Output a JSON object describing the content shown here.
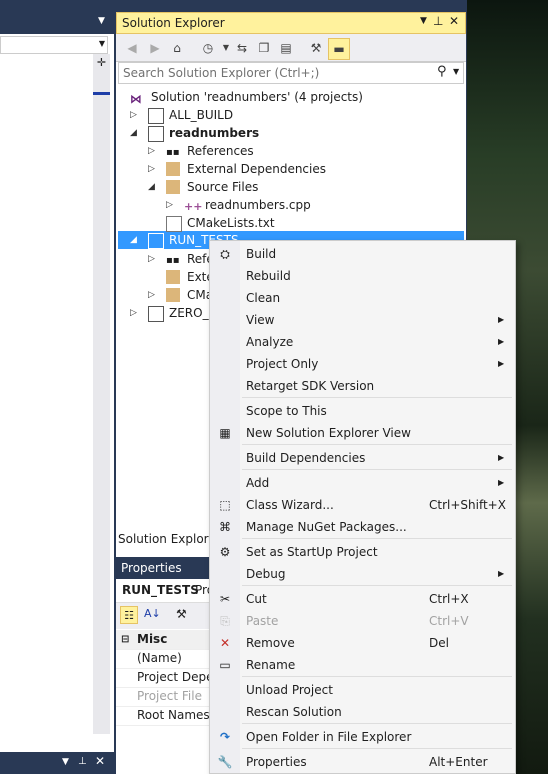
{
  "solution_explorer": {
    "title": "Solution Explorer",
    "search_placeholder": "Search Solution Explorer (Ctrl+;)",
    "bottom_tab": "Solution Explorer",
    "tree": [
      {
        "label": "Solution 'readnumbers' (4 projects)",
        "bold": false
      },
      {
        "label": "ALL_BUILD",
        "bold": false
      },
      {
        "label": "readnumbers",
        "bold": true
      },
      {
        "label": "References",
        "bold": false
      },
      {
        "label": "External Dependencies",
        "bold": false
      },
      {
        "label": "Source Files",
        "bold": false
      },
      {
        "label": "readnumbers.cpp",
        "bold": false
      },
      {
        "label": "CMakeLists.txt",
        "bold": false
      },
      {
        "label": "RUN_TESTS",
        "bold": false
      },
      {
        "label": "Refe",
        "bold": false
      },
      {
        "label": "Exte",
        "bold": false
      },
      {
        "label": "CMa",
        "bold": false
      },
      {
        "label": "ZERO_C",
        "bold": false
      }
    ]
  },
  "properties": {
    "title": "Properties",
    "object": "RUN_TESTS",
    "object_suffix": "Pro",
    "category": "Misc",
    "rows": [
      "(Name)",
      "Project Depen",
      "Project File",
      "Root Namesp"
    ]
  },
  "context_menu": {
    "items": [
      {
        "label": "Build",
        "shortcut": "",
        "submenu": false,
        "disabled": false,
        "icon": "build-icon"
      },
      {
        "label": "Rebuild",
        "shortcut": "",
        "submenu": false,
        "disabled": false,
        "icon": ""
      },
      {
        "label": "Clean",
        "shortcut": "",
        "submenu": false,
        "disabled": false,
        "icon": ""
      },
      {
        "label": "View",
        "shortcut": "",
        "submenu": true,
        "disabled": false,
        "icon": ""
      },
      {
        "label": "Analyze",
        "shortcut": "",
        "submenu": true,
        "disabled": false,
        "icon": ""
      },
      {
        "label": "Project Only",
        "shortcut": "",
        "submenu": true,
        "disabled": false,
        "icon": ""
      },
      {
        "label": "Retarget SDK Version",
        "shortcut": "",
        "submenu": false,
        "disabled": false,
        "icon": ""
      },
      {
        "label": "Scope to This",
        "shortcut": "",
        "submenu": false,
        "disabled": false,
        "icon": ""
      },
      {
        "label": "New Solution Explorer View",
        "shortcut": "",
        "submenu": false,
        "disabled": false,
        "icon": "new-view-icon"
      },
      {
        "label": "Build Dependencies",
        "shortcut": "",
        "submenu": true,
        "disabled": false,
        "icon": ""
      },
      {
        "label": "Add",
        "shortcut": "",
        "submenu": true,
        "disabled": false,
        "icon": ""
      },
      {
        "label": "Class Wizard...",
        "shortcut": "Ctrl+Shift+X",
        "submenu": false,
        "disabled": false,
        "icon": "class-wizard-icon"
      },
      {
        "label": "Manage NuGet Packages...",
        "shortcut": "",
        "submenu": false,
        "disabled": false,
        "icon": "nuget-icon"
      },
      {
        "label": "Set as StartUp Project",
        "shortcut": "",
        "submenu": false,
        "disabled": false,
        "icon": "gear-icon"
      },
      {
        "label": "Debug",
        "shortcut": "",
        "submenu": true,
        "disabled": false,
        "icon": ""
      },
      {
        "label": "Cut",
        "shortcut": "Ctrl+X",
        "submenu": false,
        "disabled": false,
        "icon": "scissors-icon"
      },
      {
        "label": "Paste",
        "shortcut": "Ctrl+V",
        "submenu": false,
        "disabled": true,
        "icon": "paste-icon"
      },
      {
        "label": "Remove",
        "shortcut": "Del",
        "submenu": false,
        "disabled": false,
        "icon": "remove-x-icon"
      },
      {
        "label": "Rename",
        "shortcut": "",
        "submenu": false,
        "disabled": false,
        "icon": "rename-icon"
      },
      {
        "label": "Unload Project",
        "shortcut": "",
        "submenu": false,
        "disabled": false,
        "icon": ""
      },
      {
        "label": "Rescan Solution",
        "shortcut": "",
        "submenu": false,
        "disabled": false,
        "icon": ""
      },
      {
        "label": "Open Folder in File Explorer",
        "shortcut": "",
        "submenu": false,
        "disabled": false,
        "icon": "open-folder-icon"
      },
      {
        "label": "Properties",
        "shortcut": "Alt+Enter",
        "submenu": false,
        "disabled": false,
        "icon": "wrench-icon"
      }
    ]
  },
  "colors": {
    "selection": "#3399ff",
    "title_active": "#fff29d",
    "chrome": "#293955"
  }
}
